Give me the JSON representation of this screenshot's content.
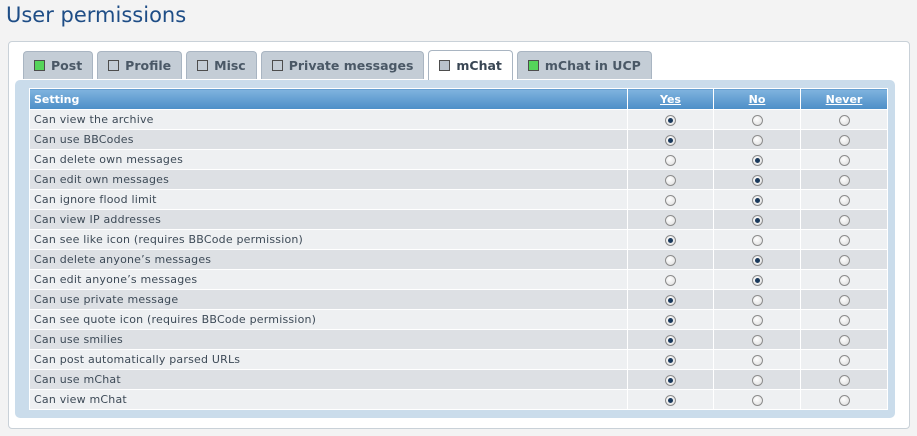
{
  "page": {
    "title": "User permissions"
  },
  "tabs": [
    {
      "label": "Post",
      "color": "#55d45a",
      "active": false
    },
    {
      "label": "Profile",
      "color": "#c4cdd6",
      "active": false
    },
    {
      "label": "Misc",
      "color": "#c4cdd6",
      "active": false
    },
    {
      "label": "Private messages",
      "color": "#c4cdd6",
      "active": false
    },
    {
      "label": "mChat",
      "color": "#b9c2cc",
      "active": true
    },
    {
      "label": "mChat in UCP",
      "color": "#55d45a",
      "active": false
    }
  ],
  "table": {
    "headers": {
      "setting": "Setting",
      "yes": "Yes",
      "no": "No",
      "never": "Never"
    },
    "rows": [
      {
        "label": "Can view the archive",
        "value": "yes"
      },
      {
        "label": "Can use BBCodes",
        "value": "yes"
      },
      {
        "label": "Can delete own messages",
        "value": "no"
      },
      {
        "label": "Can edit own messages",
        "value": "no"
      },
      {
        "label": "Can ignore flood limit",
        "value": "no"
      },
      {
        "label": "Can view IP addresses",
        "value": "no"
      },
      {
        "label": "Can see like icon (requires BBCode permission)",
        "value": "yes"
      },
      {
        "label": "Can delete anyone’s messages",
        "value": "no"
      },
      {
        "label": "Can edit anyone’s messages",
        "value": "no"
      },
      {
        "label": "Can use private message",
        "value": "yes"
      },
      {
        "label": "Can see quote icon (requires BBCode permission)",
        "value": "yes"
      },
      {
        "label": "Can use smilies",
        "value": "yes"
      },
      {
        "label": "Can post automatically parsed URLs",
        "value": "yes"
      },
      {
        "label": "Can use mChat",
        "value": "yes"
      },
      {
        "label": "Can view mChat",
        "value": "yes"
      }
    ]
  }
}
